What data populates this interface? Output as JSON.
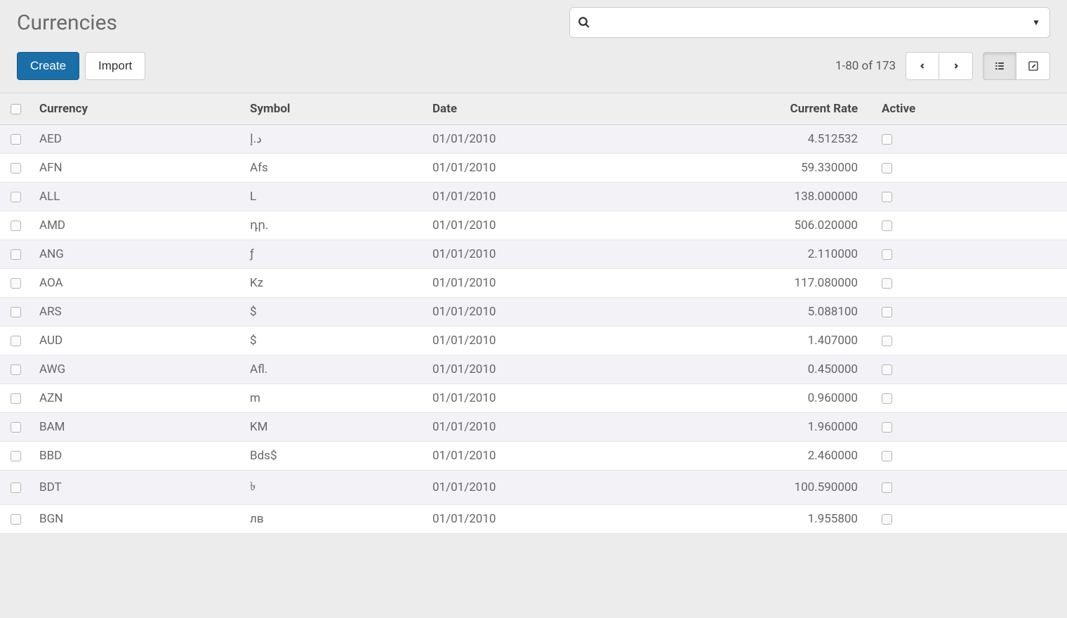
{
  "page": {
    "title": "Currencies"
  },
  "toolbar": {
    "create_label": "Create",
    "import_label": "Import"
  },
  "search": {
    "placeholder": ""
  },
  "pager": {
    "text": "1-80 of 173"
  },
  "table": {
    "headers": {
      "currency": "Currency",
      "symbol": "Symbol",
      "date": "Date",
      "rate": "Current Rate",
      "active": "Active"
    },
    "rows": [
      {
        "currency": "AED",
        "symbol": "د.إ",
        "date": "01/01/2010",
        "rate": "4.512532",
        "active": false
      },
      {
        "currency": "AFN",
        "symbol": "Afs",
        "date": "01/01/2010",
        "rate": "59.330000",
        "active": false
      },
      {
        "currency": "ALL",
        "symbol": "L",
        "date": "01/01/2010",
        "rate": "138.000000",
        "active": false
      },
      {
        "currency": "AMD",
        "symbol": "դր.",
        "date": "01/01/2010",
        "rate": "506.020000",
        "active": false
      },
      {
        "currency": "ANG",
        "symbol": "ƒ",
        "date": "01/01/2010",
        "rate": "2.110000",
        "active": false
      },
      {
        "currency": "AOA",
        "symbol": "Kz",
        "date": "01/01/2010",
        "rate": "117.080000",
        "active": false
      },
      {
        "currency": "ARS",
        "symbol": "$",
        "date": "01/01/2010",
        "rate": "5.088100",
        "active": false
      },
      {
        "currency": "AUD",
        "symbol": "$",
        "date": "01/01/2010",
        "rate": "1.407000",
        "active": false
      },
      {
        "currency": "AWG",
        "symbol": "Afl.",
        "date": "01/01/2010",
        "rate": "0.450000",
        "active": false
      },
      {
        "currency": "AZN",
        "symbol": "m",
        "date": "01/01/2010",
        "rate": "0.960000",
        "active": false
      },
      {
        "currency": "BAM",
        "symbol": "KM",
        "date": "01/01/2010",
        "rate": "1.960000",
        "active": false
      },
      {
        "currency": "BBD",
        "symbol": "Bds$",
        "date": "01/01/2010",
        "rate": "2.460000",
        "active": false
      },
      {
        "currency": "BDT",
        "symbol": "৳",
        "date": "01/01/2010",
        "rate": "100.590000",
        "active": false
      },
      {
        "currency": "BGN",
        "symbol": "лв",
        "date": "01/01/2010",
        "rate": "1.955800",
        "active": false
      }
    ]
  }
}
